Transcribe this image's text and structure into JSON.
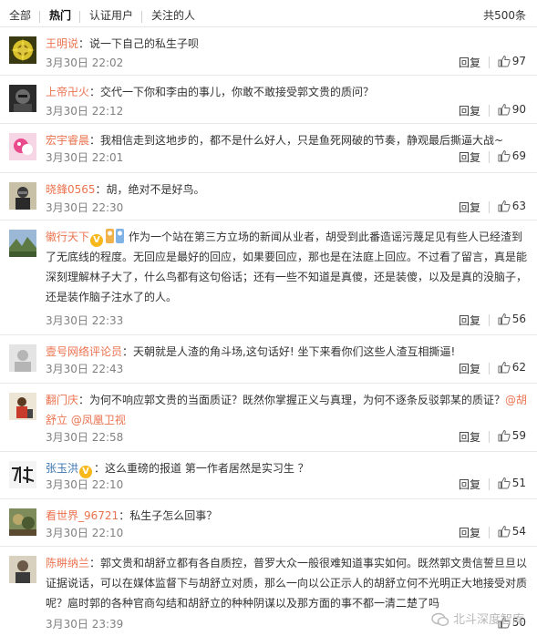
{
  "tabs": [
    {
      "label": "全部"
    },
    {
      "label": "热门"
    },
    {
      "label": "认证用户"
    },
    {
      "label": "关注的人"
    }
  ],
  "total": "共500条",
  "reply_label": "回复",
  "comments": [
    {
      "user": "王明说",
      "text": "：说一下自己的私生子呗",
      "time": "3月30日 22:02",
      "likes": "97"
    },
    {
      "user": "上帝卍火",
      "text": "：交代一下你和李由的事儿，你敢不敢接受郭文贵的质问？",
      "time": "3月30日 22:12",
      "likes": "90"
    },
    {
      "user": "宏宇睿晨",
      "text": "：我相信走到这地步的，都不是什么好人，只是鱼死网破的节奏，静观最后撕逼大战~",
      "time": "3月30日 22:01",
      "likes": "69"
    },
    {
      "user": "晓鋒0565",
      "text": "：胡，绝对不是好鸟。",
      "time": "3月30日 22:30",
      "likes": "63"
    },
    {
      "user": "徽行天下",
      "text": "作为一个站在第三方立场的新闻从业者，胡受到此番造谣污蔑足见有些人已经渣到了无底线的程度。无回应是最好的回应，如果要回应，那也是在法庭上回应。不过看了留言，真是能深刻理解林子大了，什么鸟都有这句俗话；还有一些不知道是真傻，还是装傻，以及是真的没脑子，还是装作脑子注水了的人。",
      "time": "3月30日 22:33",
      "likes": "56"
    },
    {
      "user": "壹号网络评论员",
      "text": "：天朝就是人渣的角斗场,这句话好! 坐下来看你们这些人渣互相撕逼!",
      "time": "3月30日 22:43",
      "likes": "62"
    },
    {
      "user": "翻门庆",
      "text_a": "：为何不响应郭文贵的当面质证？既然你掌握正义与真理，为何不逐条反驳郭某的质证？",
      "mention1": "@胡舒立",
      "mention2": "@凤凰卫视",
      "time": "3月30日 22:58",
      "likes": "59"
    },
    {
      "user": "张玉洪",
      "text": "：这么重磅的报道 第一作者居然是实习生 ？",
      "time": "3月30日 22:10",
      "likes": "51"
    },
    {
      "user": "看世界_96721",
      "text": "：私生子怎么回事？",
      "time": "3月30日 22:10",
      "likes": "54"
    },
    {
      "user": "陈畊纳兰",
      "text": "：郭文贵和胡舒立都有各自质控，普罗大众一般很难知道事实如何。既然郭文贵信誓旦旦以证据说话，可以在媒体监督下与胡舒立对质，那么一向以公正示人的胡舒立何不光明正大地接受对质呢？扈时郭的各种官商勾结和胡舒立的种种阴谋以及那方面的事不都一清二楚了吗",
      "time": "3月30日 23:39",
      "likes": "50"
    }
  ],
  "watermark": "北斗深度智库",
  "colors": {
    "username": "#eb7350",
    "username_blue": "#3b76b1",
    "timestamp": "#808080",
    "vip_badge": "#f8b81c",
    "divider": "#e9e9e9"
  }
}
